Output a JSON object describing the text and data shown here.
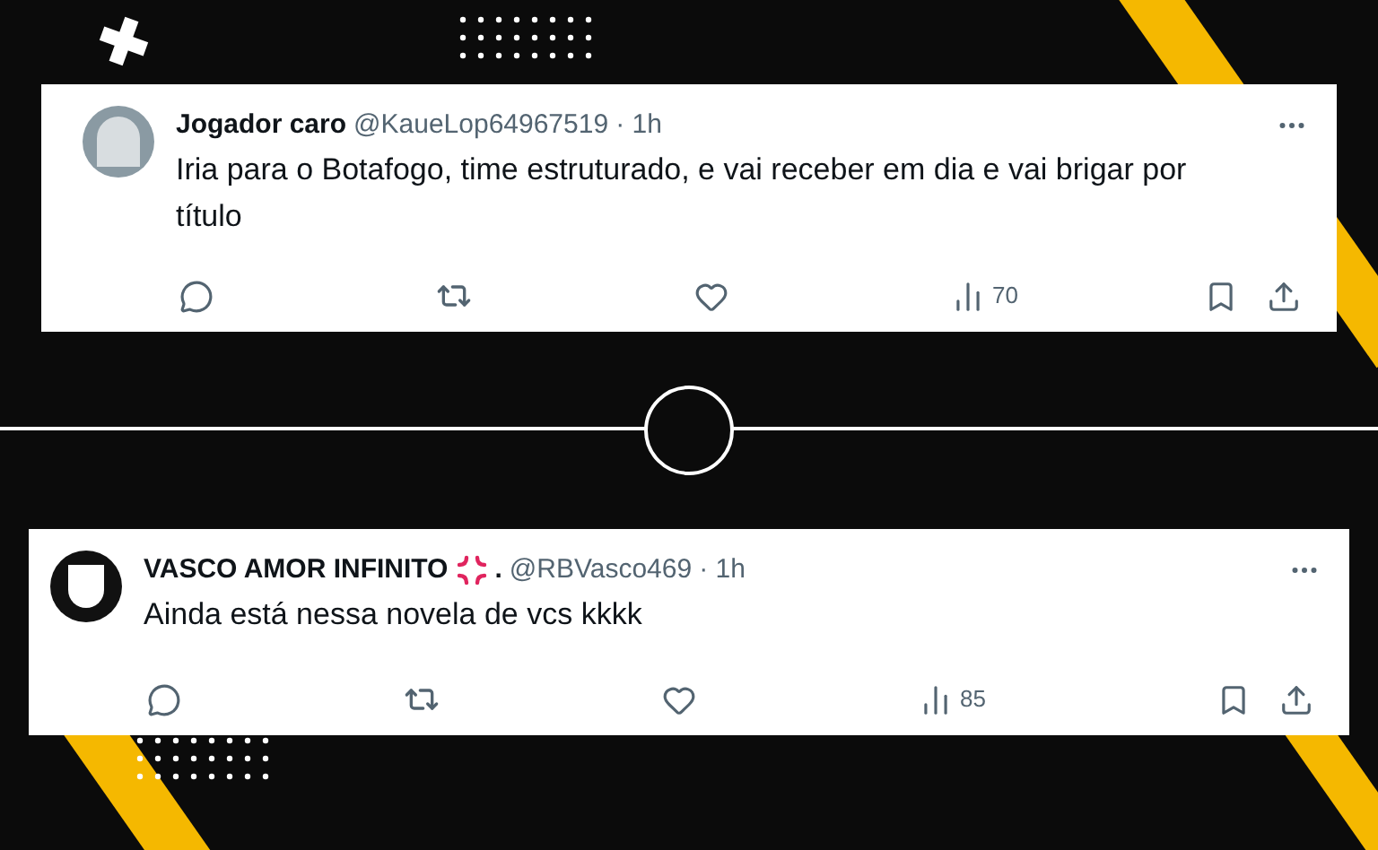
{
  "tweets": [
    {
      "name": "Jogador caro",
      "has_emoji": false,
      "handle": "@KaueLop64967519",
      "time": "· 1h",
      "text": "Iria para o Botafogo, time estruturado, e vai receber em dia e vai brigar por título",
      "views": "70"
    },
    {
      "name": "VASCO AMOR INFINITO",
      "has_emoji": true,
      "name_suffix": ".",
      "handle": "@RBVasco469",
      "time": "· 1h",
      "text": "Ainda está nessa novela de vcs kkkk",
      "views": "85"
    }
  ]
}
